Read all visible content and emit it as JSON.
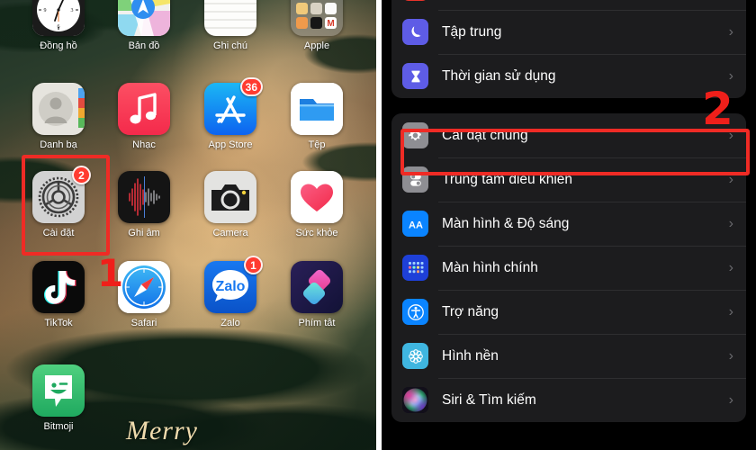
{
  "tutorial": {
    "markers": [
      {
        "num": "1",
        "target": "settings-app-icon-home-screen"
      },
      {
        "num": "2",
        "target": "general-settings-row"
      }
    ],
    "highlight_color": "#ef2b25"
  },
  "home_screen": {
    "wallpaper_text": "Merry",
    "rows": [
      {
        "apps": [
          {
            "label": "Đồng hồ",
            "icon": "clock-icon",
            "badge": null
          },
          {
            "label": "Bản đồ",
            "icon": "maps-icon",
            "badge": null
          },
          {
            "label": "Ghi chú",
            "icon": "notes-icon",
            "badge": null
          },
          {
            "label": "Apple",
            "icon": "folder-apple-icon",
            "badge": null
          }
        ]
      },
      {
        "apps": [
          {
            "label": "Danh bạ",
            "icon": "contacts-icon",
            "badge": null
          },
          {
            "label": "Nhạc",
            "icon": "music-icon",
            "badge": null
          },
          {
            "label": "App Store",
            "icon": "app-store-icon",
            "badge": "36"
          },
          {
            "label": "Tệp",
            "icon": "files-icon",
            "badge": null
          }
        ]
      },
      {
        "apps": [
          {
            "label": "Cài đặt",
            "icon": "settings-gear-icon",
            "badge": "2"
          },
          {
            "label": "Ghi âm",
            "icon": "voice-memos-icon",
            "badge": null
          },
          {
            "label": "Camera",
            "icon": "camera-icon",
            "badge": null
          },
          {
            "label": "Sức khỏe",
            "icon": "health-heart-icon",
            "badge": null
          }
        ]
      },
      {
        "apps": [
          {
            "label": "TikTok",
            "icon": "tiktok-icon",
            "badge": null
          },
          {
            "label": "Safari",
            "icon": "safari-compass-icon",
            "badge": null
          },
          {
            "label": "Zalo",
            "icon": "zalo-icon",
            "badge": "1"
          },
          {
            "label": "Phím tắt",
            "icon": "shortcuts-icon",
            "badge": null
          }
        ]
      },
      {
        "apps": [
          {
            "label": "Bitmoji",
            "icon": "bitmoji-icon",
            "badge": null
          }
        ]
      }
    ]
  },
  "settings_screen": {
    "group_one": [
      {
        "label": "Tập trung",
        "icon": "moon-focus-icon",
        "icon_color": "#5e5ce6",
        "chevron": "›"
      },
      {
        "label": "Thời gian sử dụng",
        "icon": "hourglass-screentime-icon",
        "icon_color": "#5e5ce6",
        "chevron": "›"
      }
    ],
    "group_two": [
      {
        "label": "Cài đặt chung",
        "icon": "gear-general-icon",
        "icon_color": "#8e8e93",
        "chevron": "›",
        "highlighted": true
      },
      {
        "label": "Trung tâm điều khiển",
        "icon": "control-center-toggles-icon",
        "icon_color": "#8e8e93",
        "chevron": "›",
        "highlighted": false
      },
      {
        "label": "Màn hình & Độ sáng",
        "icon": "display-aa-icon",
        "icon_color": "#0a84ff",
        "chevron": "›",
        "highlighted": false
      },
      {
        "label": "Màn hình chính",
        "icon": "home-screen-grid-icon",
        "icon_color": "#1e40d8",
        "chevron": "›",
        "highlighted": false
      },
      {
        "label": "Trợ năng",
        "icon": "accessibility-person-icon",
        "icon_color": "#0a84ff",
        "chevron": "›",
        "highlighted": false
      },
      {
        "label": "Hình nền",
        "icon": "wallpaper-flower-icon",
        "icon_color": "#3fb6e0",
        "chevron": "›",
        "highlighted": false
      },
      {
        "label": "Siri & Tìm kiếm",
        "icon": "siri-orb-icon",
        "icon_color": "#c0348e",
        "chevron": "›",
        "highlighted": false
      }
    ]
  }
}
